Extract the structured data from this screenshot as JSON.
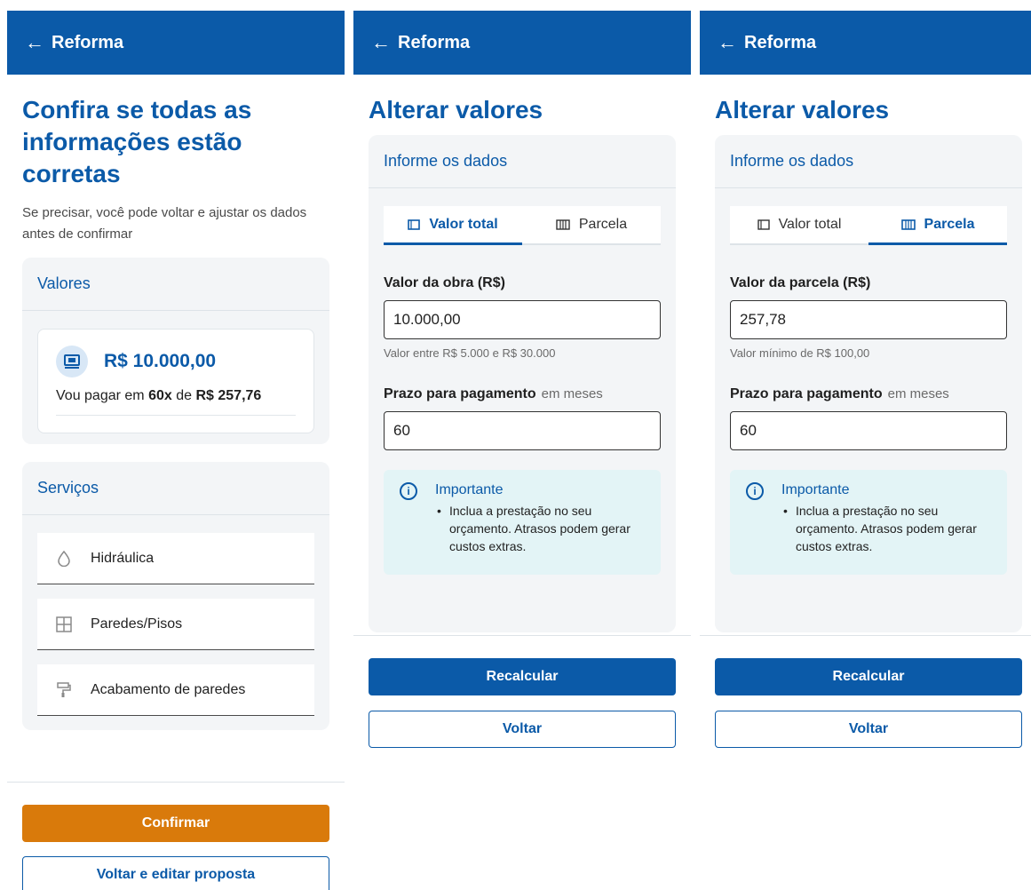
{
  "colors": {
    "brand": "#0b5aa8",
    "confirm": "#d97a0b",
    "panel": "#f3f5f7",
    "info": "#e3f4f6"
  },
  "screen1": {
    "appbar": {
      "back_icon": "arrow-left-icon",
      "title": "Reforma"
    },
    "heading": "Confira se todas as informações estão corretas",
    "subtitle": "Se precisar, você pode voltar e ajustar os dados antes de confirmar",
    "valores": {
      "title": "Valores",
      "icon": "money-icon",
      "amount": "R$ 10.000,00",
      "line_prefix": "Vou pagar em",
      "installments": "60x",
      "line_mid": "de",
      "installment_value": "R$ 257,76"
    },
    "servicos": {
      "title": "Serviços",
      "items": [
        {
          "icon": "water-drop-icon",
          "label": "Hidráulica"
        },
        {
          "icon": "grid-icon",
          "label": "Paredes/Pisos"
        },
        {
          "icon": "paint-roller-icon",
          "label": "Acabamento de paredes"
        }
      ]
    },
    "confirm_label": "Confirmar",
    "back_edit_label": "Voltar e editar proposta"
  },
  "screen2": {
    "appbar": {
      "back_icon": "arrow-left-icon",
      "title": "Reforma"
    },
    "heading": "Alterar valores",
    "panel_title": "Informe os dados",
    "tabs": [
      {
        "icon": "rectangle-icon",
        "label": "Valor total",
        "active": true
      },
      {
        "icon": "columns-icon",
        "label": "Parcela",
        "active": false
      }
    ],
    "field1": {
      "label": "Valor da obra (R$)",
      "value": "10.000,00",
      "helper": "Valor entre R$ 5.000 e R$ 30.000"
    },
    "field2": {
      "label": "Prazo para pagamento",
      "hint": "em meses",
      "value": "60"
    },
    "info": {
      "icon": "info-icon",
      "title": "Importante",
      "text": "Inclua a prestação no seu orçamento. Atrasos podem gerar custos extras."
    },
    "recalc_label": "Recalcular",
    "back_label": "Voltar"
  },
  "screen3": {
    "appbar": {
      "back_icon": "arrow-left-icon",
      "title": "Reforma"
    },
    "heading": "Alterar valores",
    "panel_title": "Informe os dados",
    "tabs": [
      {
        "icon": "rectangle-icon",
        "label": "Valor total",
        "active": false
      },
      {
        "icon": "columns-icon",
        "label": "Parcela",
        "active": true
      }
    ],
    "field1": {
      "label": "Valor da parcela (R$)",
      "value": "257,78",
      "helper": "Valor mínimo de R$ 100,00"
    },
    "field2": {
      "label": "Prazo para pagamento",
      "hint": "em meses",
      "value": "60"
    },
    "info": {
      "icon": "info-icon",
      "title": "Importante",
      "text": "Inclua a prestação no seu orçamento. Atrasos podem gerar custos extras."
    },
    "recalc_label": "Recalcular",
    "back_label": "Voltar"
  }
}
